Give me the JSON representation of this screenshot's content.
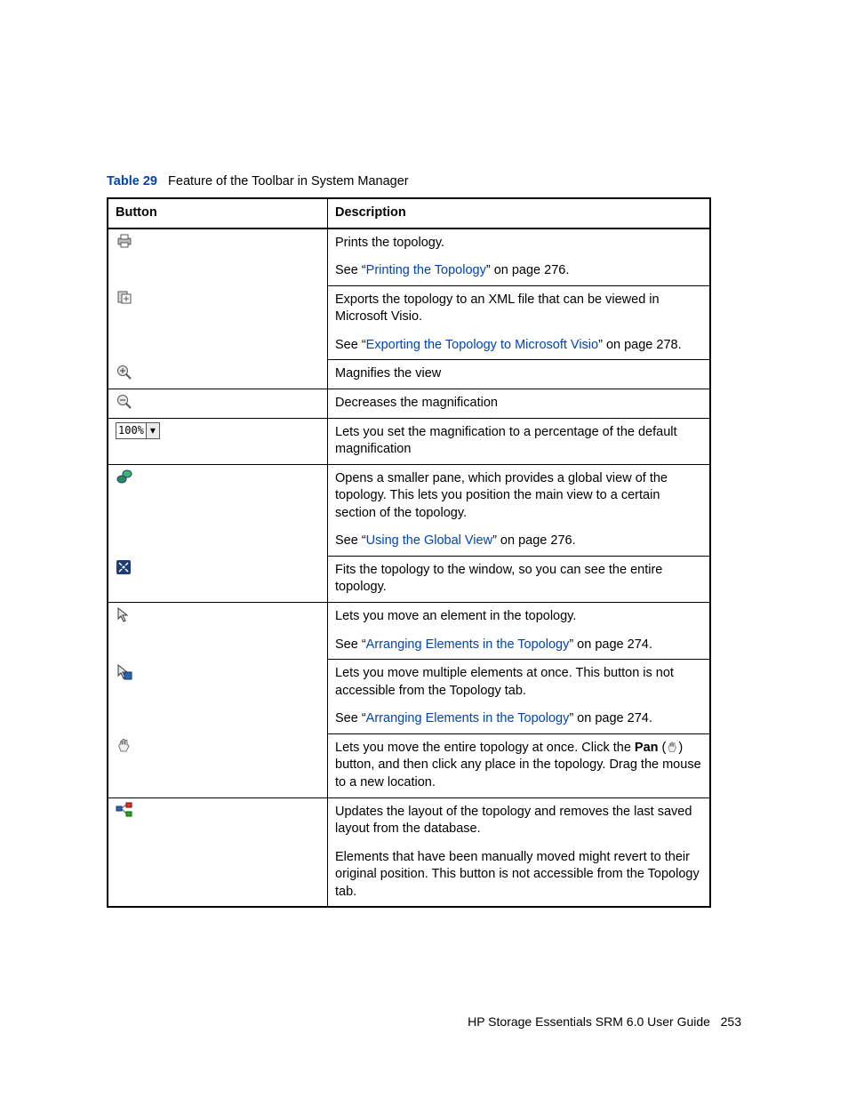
{
  "caption": {
    "label": "Table 29",
    "text": "Feature of the Toolbar in System Manager"
  },
  "headers": {
    "button": "Button",
    "description": "Description"
  },
  "zoom_value": "100%",
  "rows": {
    "print": {
      "desc1": "Prints the topology.",
      "see_pre": "See “",
      "link": "Printing the Topology",
      "see_post": "” on page 276."
    },
    "export": {
      "desc1": "Exports the topology to an XML file that can be viewed in Microsoft Visio.",
      "see_pre": "See “",
      "link": "Exporting the Topology to Microsoft Visio",
      "see_post": "” on page 278."
    },
    "zoom_in": {
      "desc1": "Magnifies the view"
    },
    "zoom_out": {
      "desc1": "Decreases the magnification"
    },
    "zoom_pct": {
      "desc1": "Lets you set the magnification to a percentage of the default magnification"
    },
    "global_view": {
      "desc1": "Opens a smaller pane, which provides a global view of the topology. This lets you position the main view to a certain section of the topology.",
      "see_pre": "See “",
      "link": "Using the Global View",
      "see_post": "” on page 276."
    },
    "fit": {
      "desc1": "Fits the topology to the window, so you can see the entire topology."
    },
    "move_one": {
      "desc1": "Lets you move an element in the topology.",
      "see_pre": "See “",
      "link": "Arranging Elements in the Topology",
      "see_post": "” on page 274."
    },
    "move_multi": {
      "desc1": "Lets you move multiple elements at once. This button is not accessible from the Topology tab.",
      "see_pre": "See “",
      "link": "Arranging Elements in the Topology",
      "see_post": "” on page 274."
    },
    "pan": {
      "pre": "Lets you move the entire topology at once. Click the ",
      "bold": "Pan",
      "mid": " (",
      "post": ") button, and then click any place in the topology. Drag the mouse to a new location."
    },
    "update_layout": {
      "desc1": "Updates the layout of the topology and removes the last saved layout from the database.",
      "desc2": "Elements that have been manually moved might revert to their original position. This button is not accessible from the Topology tab."
    }
  },
  "footer": {
    "title": "HP Storage Essentials SRM 6.0 User Guide",
    "page": "253"
  }
}
